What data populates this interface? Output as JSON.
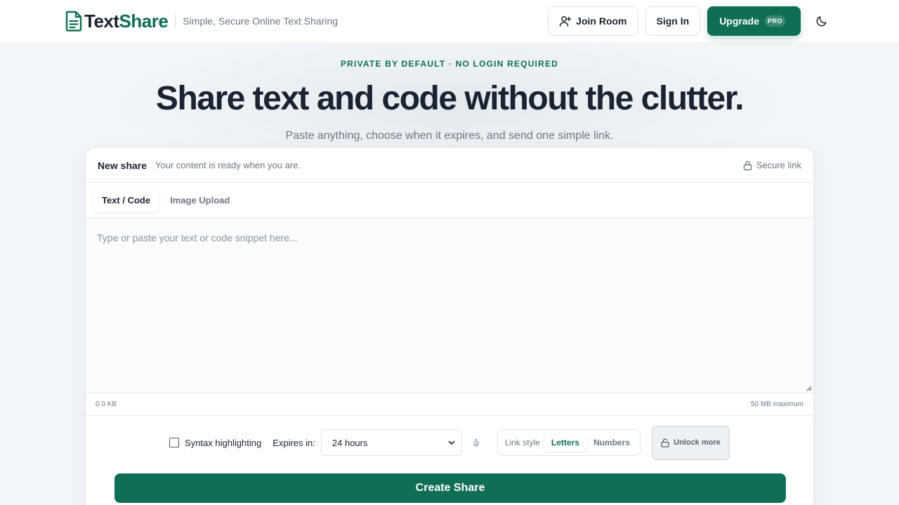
{
  "header": {
    "brand_part1": "Text",
    "brand_part2": "Share",
    "tagline": "Simple, Secure Online Text Sharing",
    "join_room_label": "Join Room",
    "sign_in_label": "Sign In",
    "upgrade_label": "Upgrade",
    "pro_badge": "PRO"
  },
  "hero": {
    "eyebrow": "PRIVATE BY DEFAULT · NO LOGIN REQUIRED",
    "title": "Share text and code without the clutter.",
    "subtitle": "Paste anything, choose when it expires, and send one simple link."
  },
  "card": {
    "title": "New share",
    "description": "Your content is ready when you are.",
    "secure_label": "Secure link",
    "tabs": [
      {
        "label": "Text / Code",
        "active": true
      },
      {
        "label": "Image Upload",
        "active": false
      }
    ],
    "editor_placeholder": "Type or paste your text or code snippet here...",
    "size_current": "0.0 KB",
    "size_max": "50 MB maximum",
    "syntax_label": "Syntax highlighting",
    "syntax_checked": false,
    "expires_label": "Expires in:",
    "expires_value": "24 hours",
    "link_style_label": "Link style",
    "link_style_options": [
      {
        "label": "Letters",
        "active": true
      },
      {
        "label": "Numbers",
        "active": false
      }
    ],
    "unlock_label": "Unlock more",
    "create_label": "Create Share"
  },
  "icons": {
    "brand": "document-icon",
    "join": "user-plus-icon",
    "theme": "moon-icon",
    "secure": "lock-icon",
    "fire": "flame-icon",
    "unlock": "unlock-icon",
    "select": "chevron-down-icon"
  },
  "colors": {
    "accent": "#0f6e55",
    "text": "#1a2332",
    "muted": "#6b7785",
    "background": "#f3f6f9"
  }
}
